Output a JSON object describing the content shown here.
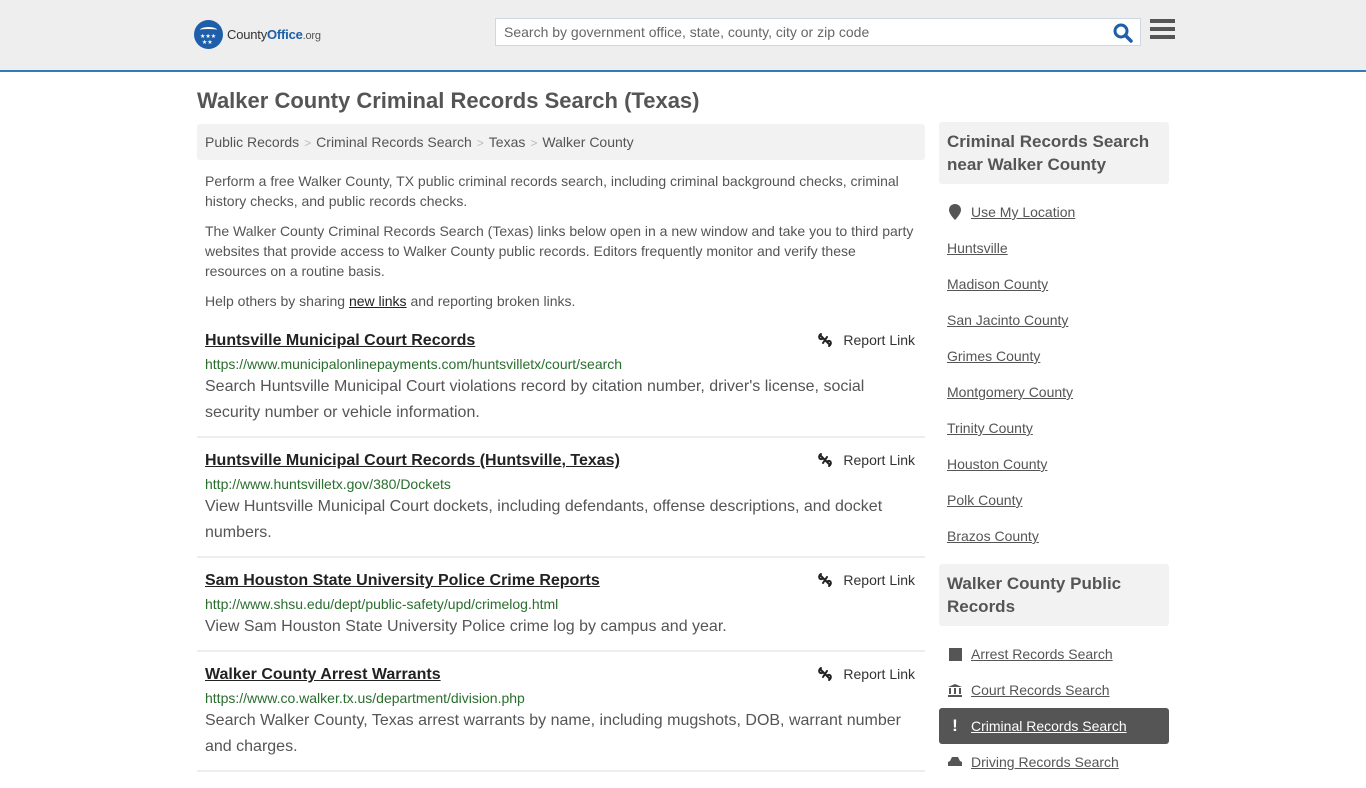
{
  "header": {
    "logo": {
      "county": "County",
      "office": "Office",
      "org": ".org"
    },
    "search_placeholder": "Search by government office, state, county, city or zip code",
    "search_icon": "search-icon",
    "menu_icon": "hamburger-menu-icon"
  },
  "page": {
    "title": "Walker County Criminal Records Search (Texas)"
  },
  "breadcrumb": [
    "Public Records",
    "Criminal Records Search",
    "Texas",
    "Walker County"
  ],
  "intro": {
    "p1": "Perform a free Walker County, TX public criminal records search, including criminal background checks, criminal history checks, and public records checks.",
    "p2": "The Walker County Criminal Records Search (Texas) links below open in a new window and take you to third party websites that provide access to Walker County public records. Editors frequently monitor and verify these resources on a routine basis.",
    "p3_before": "Help others by sharing ",
    "p3_link": "new links",
    "p3_after": " and reporting broken links."
  },
  "report_label": "Report Link",
  "results": [
    {
      "title": "Huntsville Municipal Court Records",
      "url": "https://www.municipalonlinepayments.com/huntsvilletx/court/search",
      "description": "Search Huntsville Municipal Court violations record by citation number, driver's license, social security number or vehicle information."
    },
    {
      "title": "Huntsville Municipal Court Records (Huntsville, Texas)",
      "url": "http://www.huntsvilletx.gov/380/Dockets",
      "description": "View Huntsville Municipal Court dockets, including defendants, offense descriptions, and docket numbers."
    },
    {
      "title": "Sam Houston State University Police Crime Reports",
      "url": "http://www.shsu.edu/dept/public-safety/upd/crimelog.html",
      "description": "View Sam Houston State University Police crime log by campus and year."
    },
    {
      "title": "Walker County Arrest Warrants",
      "url": "https://www.co.walker.tx.us/department/division.php",
      "description": "Search Walker County, Texas arrest warrants by name, including mugshots, DOB, warrant number and charges."
    }
  ],
  "sidebar": {
    "nearby": {
      "heading": "Criminal Records Search near Walker County",
      "use_location": "Use My Location",
      "items": [
        "Huntsville",
        "Madison County",
        "San Jacinto County",
        "Grimes County",
        "Montgomery County",
        "Trinity County",
        "Houston County",
        "Polk County",
        "Brazos County"
      ]
    },
    "public_records": {
      "heading": "Walker County Public Records",
      "items": [
        {
          "label": "Arrest Records Search",
          "icon": "square-icon",
          "active": false
        },
        {
          "label": "Court Records Search",
          "icon": "courthouse-icon",
          "active": false
        },
        {
          "label": "Criminal Records Search",
          "icon": "exclamation-icon",
          "active": true
        },
        {
          "label": "Driving Records Search",
          "icon": "car-icon",
          "active": false
        }
      ]
    }
  },
  "colors": {
    "accent": "#337ab7",
    "brand": "#1f5ea8",
    "url_green": "#2a6e2e",
    "active_bg": "#555555"
  }
}
